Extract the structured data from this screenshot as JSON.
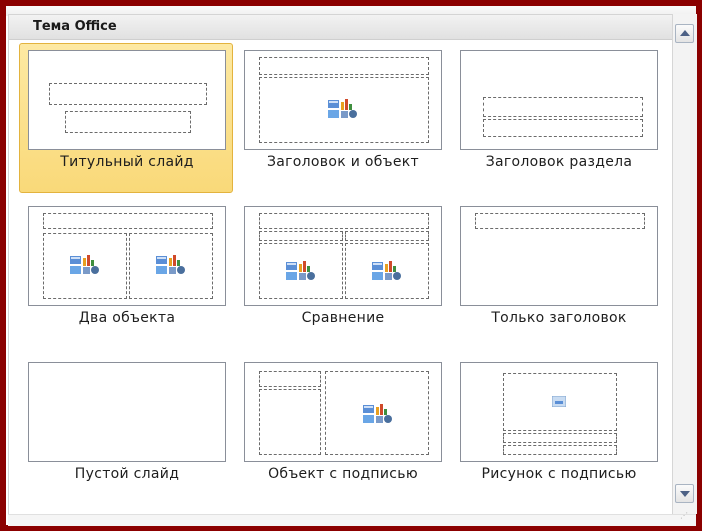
{
  "gallery": {
    "header": "Тема Office",
    "layouts": [
      {
        "label": "Титульный слайд",
        "selected": true
      },
      {
        "label": "Заголовок и объект",
        "selected": false
      },
      {
        "label": "Заголовок раздела",
        "selected": false
      },
      {
        "label": "Два объекта",
        "selected": false
      },
      {
        "label": "Сравнение",
        "selected": false
      },
      {
        "label": "Только заголовок",
        "selected": false
      },
      {
        "label": "Пустой слайд",
        "selected": false
      },
      {
        "label": "Объект с подписью",
        "selected": false
      },
      {
        "label": "Рисунок с подписью",
        "selected": false
      }
    ]
  },
  "colors": {
    "frame": "#8b0000",
    "selection": "#f9d979",
    "selection_border": "#e3b33e"
  },
  "icons": {
    "content_placeholder": "content-placeholder-icon",
    "picture_placeholder": "picture-placeholder-icon",
    "scroll_up": "chevron-up-icon",
    "scroll_down": "chevron-down-icon"
  }
}
